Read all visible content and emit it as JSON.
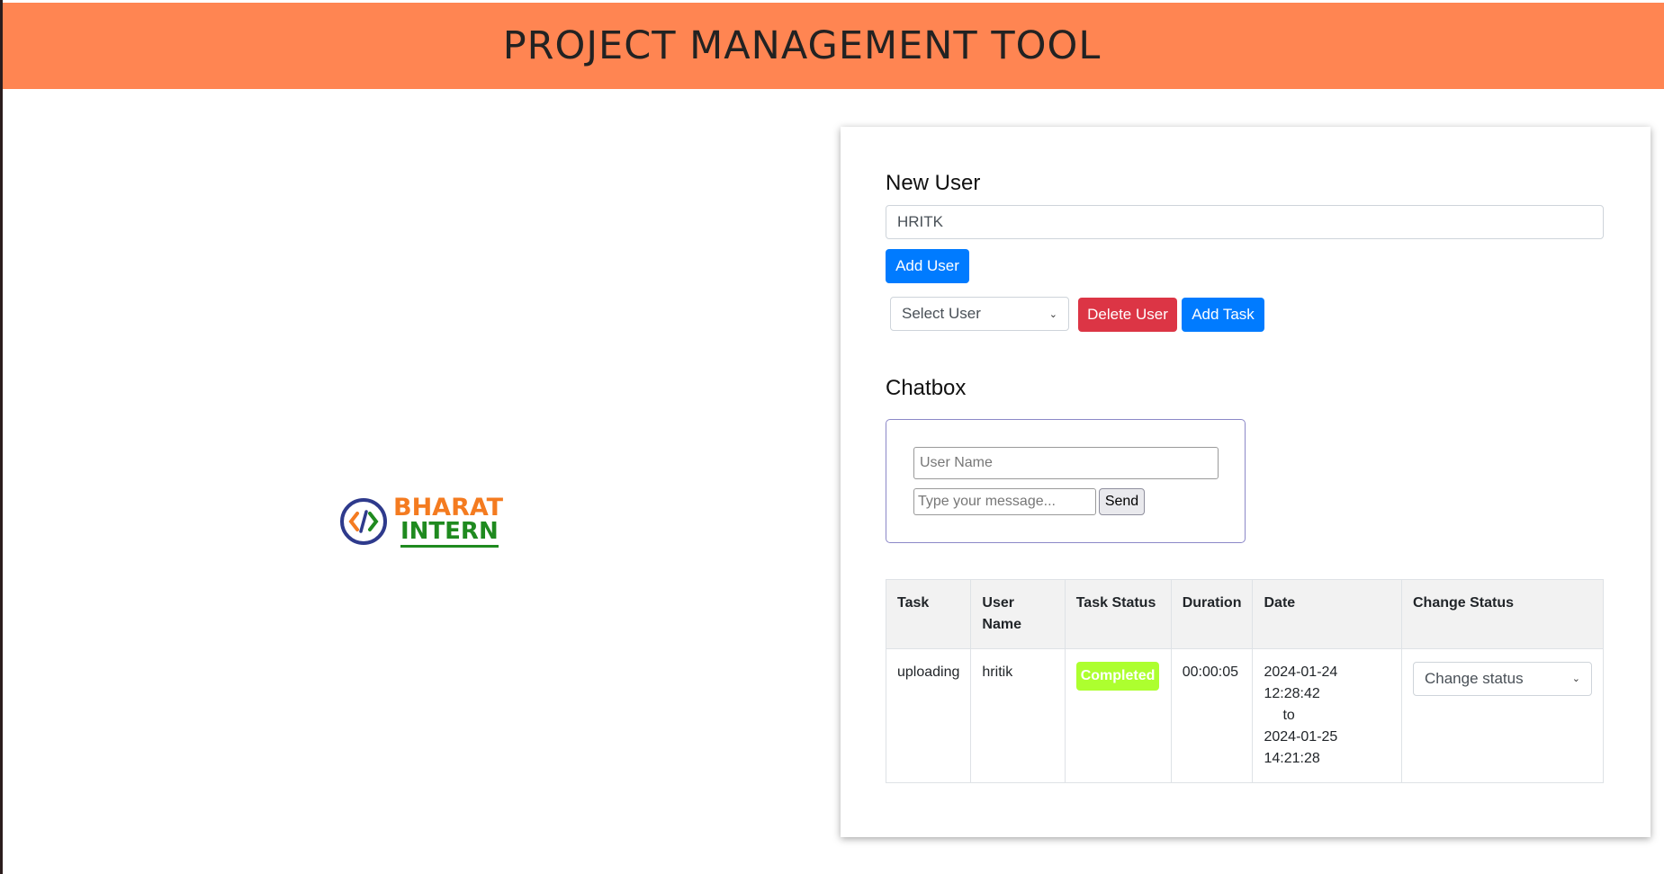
{
  "header": {
    "title": "PROJECT MANAGEMENT TOOL",
    "bg_color": "#ff8552"
  },
  "logo": {
    "word1": "BHARAT",
    "word2": "INTERN",
    "icon": "code-brackets-icon"
  },
  "new_user": {
    "title": "New User",
    "input_value": "HRITK",
    "add_user_label": "Add User",
    "select_user_value": "Select User",
    "delete_user_label": "Delete User",
    "add_task_label": "Add Task"
  },
  "chatbox": {
    "title": "Chatbox",
    "user_name_placeholder": "User Name",
    "message_placeholder": "Type your message...",
    "send_label": "Send"
  },
  "table": {
    "headers": [
      "Task",
      "User Name",
      "Task Status",
      "Duration",
      "Date",
      "Change Status"
    ],
    "rows": [
      {
        "task": "uploading",
        "user_name": "hritik",
        "status": "Completed",
        "duration": "00:00:05",
        "date_start_day": "2024-01-24",
        "date_start_time": "12:28:42",
        "date_sep": "to",
        "date_end_day": "2024-01-25",
        "date_end_time": "14:21:28",
        "change_status_value": "Change status"
      }
    ]
  },
  "colors": {
    "primary": "#007bff",
    "danger": "#dc3545",
    "status_completed": "#adff2f"
  }
}
